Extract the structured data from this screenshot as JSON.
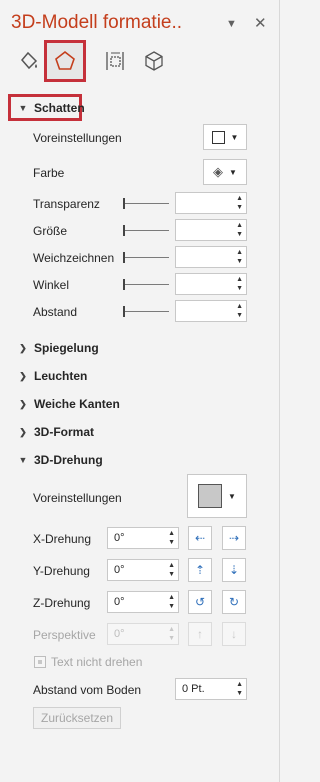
{
  "pane": {
    "title": "3D-Modell formatie..",
    "dropdown_icon": "chevron-down-icon",
    "close_icon": "close-icon"
  },
  "tabs": [
    {
      "name": "fill-line-icon"
    },
    {
      "name": "effects-icon",
      "active": true
    },
    {
      "name": "size-properties-icon"
    },
    {
      "name": "3d-model-icon"
    }
  ],
  "schatten": {
    "header": "Schatten",
    "voreinstellungen": "Voreinstellungen",
    "farbe": "Farbe",
    "transparenz": "Transparenz",
    "groesse": "Größe",
    "weichzeichnen": "Weichzeichnen",
    "winkel": "Winkel",
    "abstand": "Abstand"
  },
  "sections": {
    "spiegelung": "Spiegelung",
    "leuchten": "Leuchten",
    "weiche_kanten": "Weiche Kanten",
    "format_3d": "3D-Format",
    "drehung_3d": "3D-Drehung"
  },
  "drehung": {
    "voreinstellungen": "Voreinstellungen",
    "x_label": "X-Drehung",
    "x_value": "0°",
    "y_label": "Y-Drehung",
    "y_value": "0°",
    "z_label": "Z-Drehung",
    "z_value": "0°",
    "perspektive_label": "Perspektive",
    "perspektive_value": "0°",
    "text_nicht_drehen": "Text nicht drehen",
    "abstand_boden_label": "Abstand vom Boden",
    "abstand_boden_value": "0 Pt.",
    "reset_button": "Zurücksetzen"
  },
  "colors": {
    "accent": "#c43e1c",
    "highlight_border": "#c5303a",
    "icon_blue": "#2f6fba"
  }
}
